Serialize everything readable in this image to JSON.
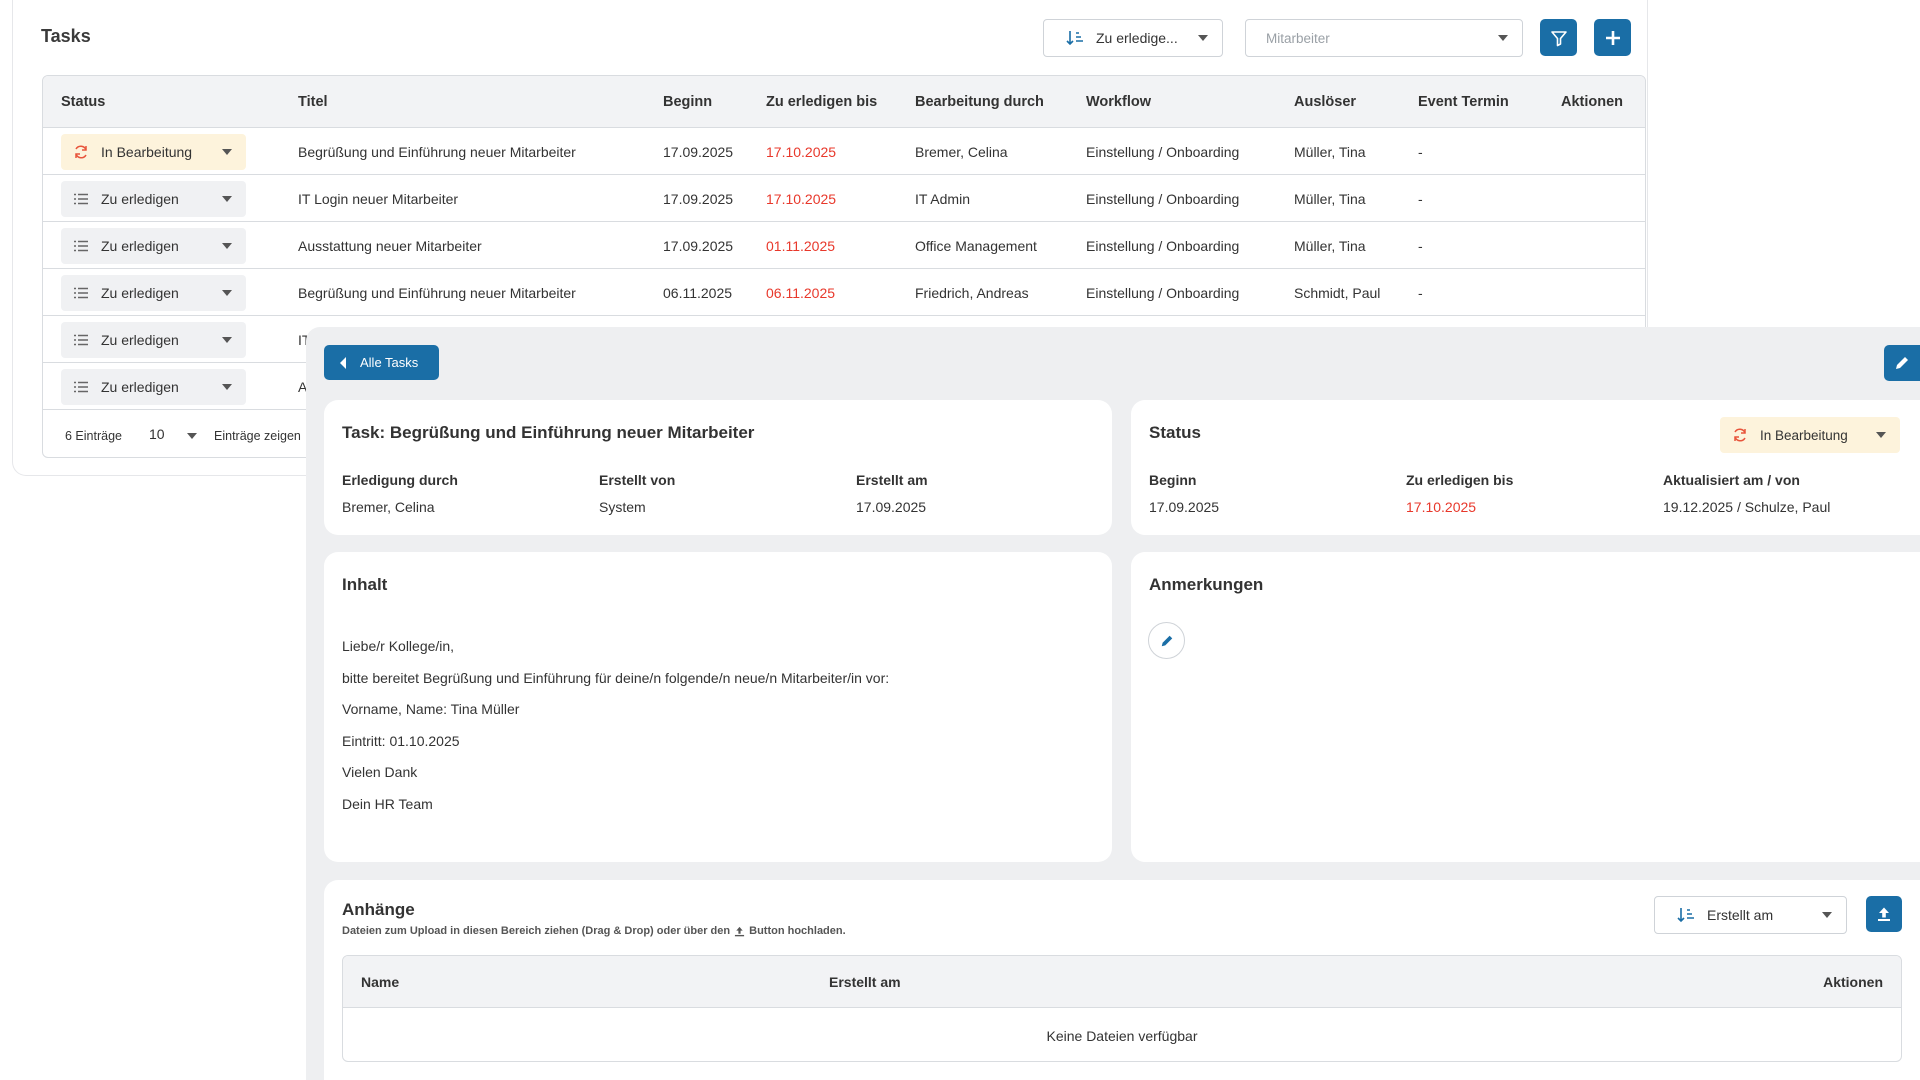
{
  "list": {
    "title": "Tasks",
    "sort_label": "Zu erledige...",
    "employee_placeholder": "Mitarbeiter",
    "columns": [
      "Status",
      "Titel",
      "Beginn",
      "Zu erledigen bis",
      "Bearbeitung durch",
      "Workflow",
      "Auslöser",
      "Event Termin",
      "Aktionen"
    ],
    "rows": [
      {
        "status": "In Bearbeitung",
        "title": "Begrüßung und Einführung neuer Mitarbeiter",
        "begin": "17.09.2025",
        "due": "17.10.2025",
        "assignee": "Bremer, Celina",
        "workflow": "Einstellung / Onboarding",
        "trigger": "Müller, Tina",
        "event": "-"
      },
      {
        "status": "Zu erledigen",
        "title": "IT Login neuer Mitarbeiter",
        "begin": "17.09.2025",
        "due": "17.10.2025",
        "assignee": "IT Admin",
        "workflow": "Einstellung / Onboarding",
        "trigger": "Müller, Tina",
        "event": "-"
      },
      {
        "status": "Zu erledigen",
        "title": "Ausstattung neuer Mitarbeiter",
        "begin": "17.09.2025",
        "due": "01.11.2025",
        "assignee": "Office Management",
        "workflow": "Einstellung / Onboarding",
        "trigger": "Müller, Tina",
        "event": "-"
      },
      {
        "status": "Zu erledigen",
        "title": "Begrüßung und Einführung neuer Mitarbeiter",
        "begin": "06.11.2025",
        "due": "06.11.2025",
        "assignee": "Friedrich, Andreas",
        "workflow": "Einstellung / Onboarding",
        "trigger": "Schmidt, Paul",
        "event": "-"
      },
      {
        "status": "Zu erledigen",
        "title": "IT Lo",
        "begin": "",
        "due": "",
        "assignee": "",
        "workflow": "",
        "trigger": "",
        "event": ""
      },
      {
        "status": "Zu erledigen",
        "title": "Aus",
        "begin": "",
        "due": "",
        "assignee": "",
        "workflow": "",
        "trigger": "",
        "event": ""
      }
    ],
    "footer": {
      "entries": "6 Einträge",
      "page_size": "10",
      "show_label": "Einträge zeigen"
    }
  },
  "detail": {
    "back_label": "Alle Tasks",
    "task_card": {
      "title": "Task: Begrüßung und Einführung neuer Mitarbeiter",
      "fields": [
        {
          "label": "Erledigung durch",
          "value": "Bremer, Celina"
        },
        {
          "label": "Erstellt von",
          "value": "System"
        },
        {
          "label": "Erstellt am",
          "value": "17.09.2025"
        }
      ]
    },
    "status_card": {
      "title": "Status",
      "status_value": "In Bearbeitung",
      "fields": [
        {
          "label": "Beginn",
          "value": "17.09.2025"
        },
        {
          "label": "Zu erledigen bis",
          "value": "17.10.2025"
        },
        {
          "label": "Aktualisiert am / von",
          "value": "19.12.2025 / Schulze, Paul"
        }
      ]
    },
    "content_card": {
      "title": "Inhalt",
      "lines": [
        "Liebe/r Kollege/in,",
        "bitte bereitet Begrüßung und Einführung für deine/n folgende/n neue/n Mitarbeiter/in vor:",
        "Vorname, Name: Tina Müller",
        "Eintritt: 01.10.2025",
        "Vielen Dank",
        "Dein HR Team"
      ]
    },
    "notes_card": {
      "title": "Anmerkungen"
    },
    "attachments_card": {
      "title": "Anhänge",
      "hint_before": "Dateien zum Upload in diesen Bereich ziehen (Drag & Drop) oder über den",
      "hint_after": "Button hochladen.",
      "sort_label": "Erstellt am",
      "columns": {
        "name": "Name",
        "created": "Erstellt am",
        "actions": "Aktionen"
      },
      "empty": "Keine Dateien verfügbar"
    }
  },
  "colors": {
    "accent": "#1a6ea6",
    "due_red": "#e8382b",
    "in_progress_bg": "#fdf3dc",
    "in_progress_icon": "#e8543b"
  },
  "icons": [
    "sort-icon",
    "chevron-down-icon",
    "filter-icon",
    "plus-icon",
    "refresh-icon",
    "list-icon",
    "chevron-left-icon",
    "pencil-icon",
    "upload-icon"
  ]
}
